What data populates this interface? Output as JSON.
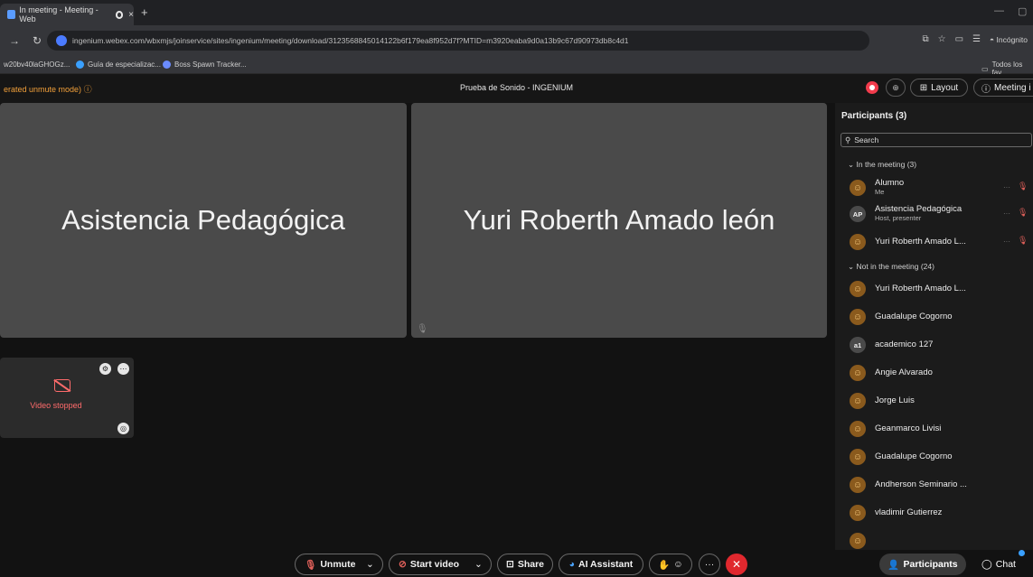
{
  "browser": {
    "tab_title": "In meeting - Meeting - Web",
    "tab_close": "×",
    "new_tab": "+",
    "url": "ingenium.webex.com/wbxmjs/joinservice/sites/ingenium/meeting/download/3123568845014122b6f179ea8f952d7f?MTID=m3920eaba9d0a13b9c67d90973db8c4d1",
    "incognito_label": "Incógnito",
    "bookmarks": [
      "w20bv40laGHOGz...",
      "Guía de especializac...",
      "Boss Spawn Tracker..."
    ],
    "all_bookmarks": "Todos los fav"
  },
  "meeting": {
    "unmute_mode": "erated unmute mode)",
    "title": "Prueba de Sonido - INGENIUM",
    "layout_label": "Layout",
    "meeting_info_label": "Meeting i"
  },
  "stage": {
    "tile1_name": "Asistencia Pedagógica",
    "tile2_name": "Yuri Roberth Amado león",
    "self_view_status": "Video stopped"
  },
  "participants": {
    "title": "Participants (3)",
    "search_placeholder": "Search",
    "in_meeting_header": "In the meeting (3)",
    "in_meeting": [
      {
        "name": "Alumno",
        "sub": "Me",
        "avatar": "person"
      },
      {
        "name": "Asistencia Pedagógica",
        "sub": "Host, presenter",
        "avatar": "AP"
      },
      {
        "name": "Yuri Roberth Amado L...",
        "sub": "",
        "avatar": "person"
      }
    ],
    "not_in_meeting_header": "Not in the meeting (24)",
    "not_in_meeting": [
      {
        "name": "Yuri Roberth Amado L...",
        "avatar": "person"
      },
      {
        "name": "Guadalupe Cogorno",
        "avatar": "person"
      },
      {
        "name": "academico 127",
        "avatar": "a1"
      },
      {
        "name": "Angie Alvarado",
        "avatar": "person"
      },
      {
        "name": "Jorge Luis",
        "avatar": "person"
      },
      {
        "name": "Geanmarco Livisi",
        "avatar": "person"
      },
      {
        "name": "Guadalupe Cogorno",
        "avatar": "person"
      },
      {
        "name": "Andherson Seminario ...",
        "avatar": "person"
      },
      {
        "name": "vladimir Gutierrez",
        "avatar": "person"
      }
    ]
  },
  "controls": {
    "unmute": "Unmute",
    "start_video": "Start video",
    "share": "Share",
    "ai_assistant": "AI Assistant",
    "participants": "Participants",
    "chat": "Chat"
  }
}
